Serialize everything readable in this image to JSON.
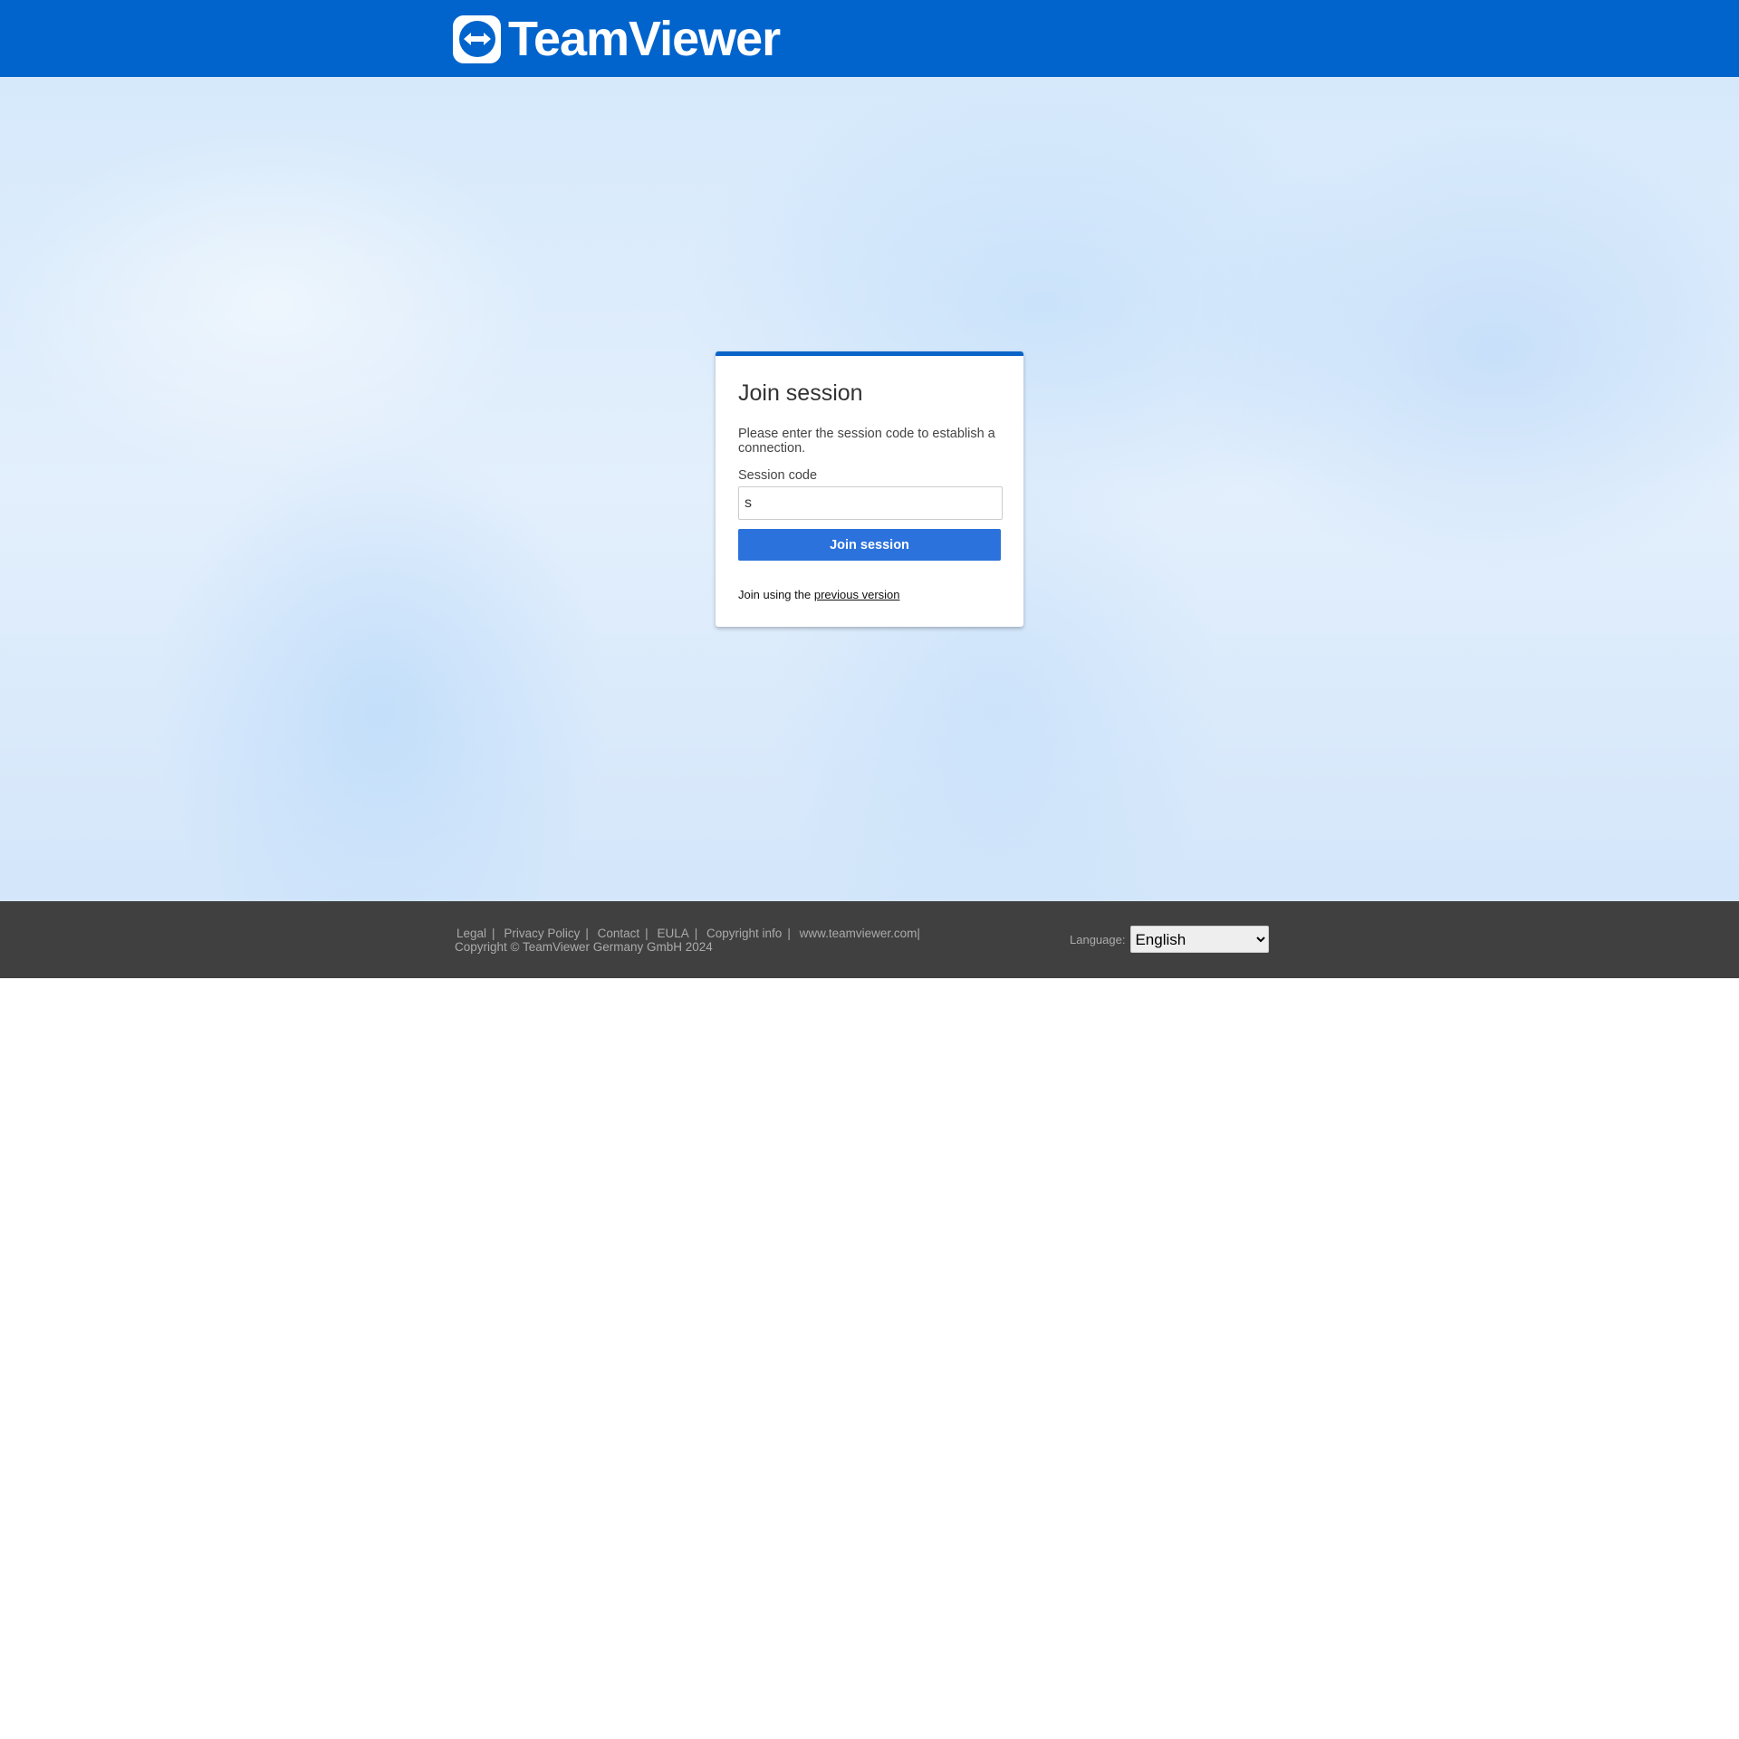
{
  "header": {
    "brand": "TeamViewer",
    "logo_icon": "teamviewer-arrows-icon",
    "color": "#0064cc"
  },
  "card": {
    "title": "Join session",
    "description": "Please enter the session code to establish a connection.",
    "field_label": "Session code",
    "field_value": "s",
    "button_label": "Join session",
    "alt_prefix": "Join using the ",
    "alt_link": "previous version",
    "accent": "#2b72dc"
  },
  "footer": {
    "links": [
      "Legal",
      "Privacy Policy",
      "Contact",
      "EULA",
      "Copyright info",
      "www.teamviewer.com"
    ],
    "copyright": "Copyright © TeamViewer Germany GmbH 2024",
    "language_label": "Language:",
    "language_value": "English"
  }
}
